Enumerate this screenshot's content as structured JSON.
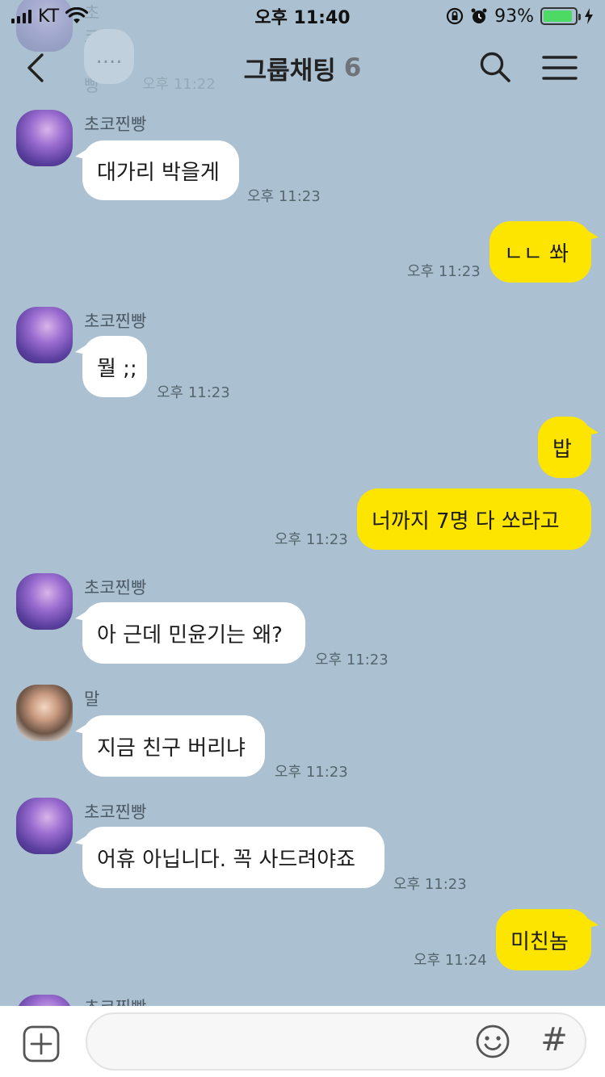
{
  "status_bar": {
    "carrier": "KT",
    "time": "오후 11:40",
    "battery": "93%",
    "battery_level": 0.93
  },
  "header": {
    "title": "그룹채팅",
    "member_count": "6"
  },
  "ghost": {
    "sender": "초코찐빵",
    "typing": "....",
    "time": "오후 11:22"
  },
  "messages": [
    {
      "sender": "초코찐빵",
      "text": "대가리 박을게",
      "time": "오후 11:23"
    },
    {
      "text": "ㄴㄴ 쏴",
      "time": "오후 11:23"
    },
    {
      "sender": "초코찐빵",
      "text": "뭘 ;;",
      "time": "오후 11:23"
    },
    {
      "text": "밥"
    },
    {
      "text": "너까지 7명 다 쏘라고",
      "time": "오후 11:23"
    },
    {
      "sender": "초코찐빵",
      "text": "아 근데 민윤기는 왜?",
      "time": "오후 11:23"
    },
    {
      "sender": "말",
      "text": "지금 친구 버리냐",
      "time": "오후 11:23"
    },
    {
      "sender": "초코찐빵",
      "text": "어휴 아닙니다. 꼭 사드려야죠",
      "time": "오후 11:23"
    },
    {
      "text": "미친놈",
      "time": "오후 11:24"
    }
  ],
  "partial_sender": "초코찐빵",
  "input": {
    "placeholder": "",
    "hash_label": "#"
  },
  "colors": {
    "background": "#abc1d1",
    "outgoing_bubble": "#fee500",
    "incoming_bubble": "#ffffff",
    "battery_fill": "#4cd964"
  }
}
